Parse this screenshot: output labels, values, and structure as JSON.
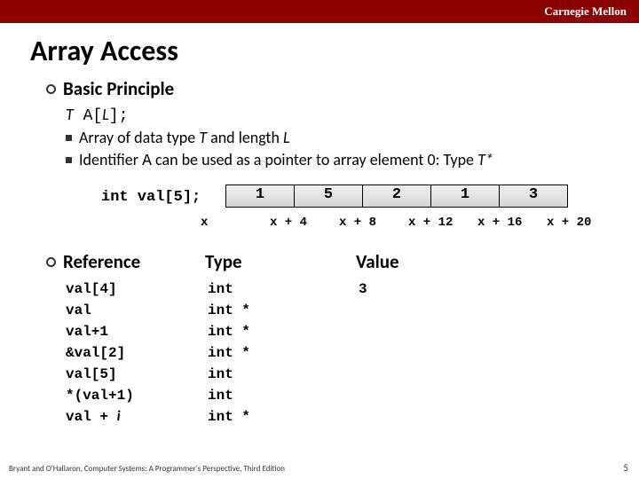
{
  "header": {
    "brand": "Carnegie Mellon"
  },
  "title": "Array Access",
  "basic_principle": {
    "heading": "Basic Principle",
    "decl_T": "T",
    "decl_A": " A[",
    "decl_L": "L",
    "decl_end": "];",
    "bullets": [
      {
        "pre": "Array of data type ",
        "em1": "T",
        "mid": " and length ",
        "em2": "L",
        "post": ""
      },
      {
        "pre": "Identifier ",
        "code": "A",
        "mid": " can be used as a pointer to array element 0: Type ",
        "em2": "T*",
        "post": ""
      }
    ]
  },
  "array_fig": {
    "decl": "int val[5];",
    "cells": [
      "1",
      "5",
      "2",
      "1",
      "3"
    ],
    "addrs": [
      "x",
      "x + 4",
      "x + 8",
      "x + 12",
      "x + 16",
      "x + 20"
    ]
  },
  "reference": {
    "heading": "Reference",
    "type_heading": "Type",
    "value_heading": "Value",
    "rows": [
      {
        "ref": "val[4]",
        "type": "int",
        "value": "3"
      },
      {
        "ref": "val",
        "type": "int *",
        "value": ""
      },
      {
        "ref": "val+1",
        "type": "int *",
        "value": ""
      },
      {
        "ref": "&val[2]",
        "type": "int *",
        "value": ""
      },
      {
        "ref": "val[5]",
        "type": "int",
        "value": ""
      },
      {
        "ref": "*(val+1)",
        "type": "int",
        "value": ""
      },
      {
        "ref_pre": "val + ",
        "ref_ital": "i",
        "type": "int *",
        "value": ""
      }
    ]
  },
  "footer": {
    "credit": "Bryant and O'Hallaron, Computer Systems: A Programmer's Perspective, Third Edition",
    "page": "5"
  }
}
